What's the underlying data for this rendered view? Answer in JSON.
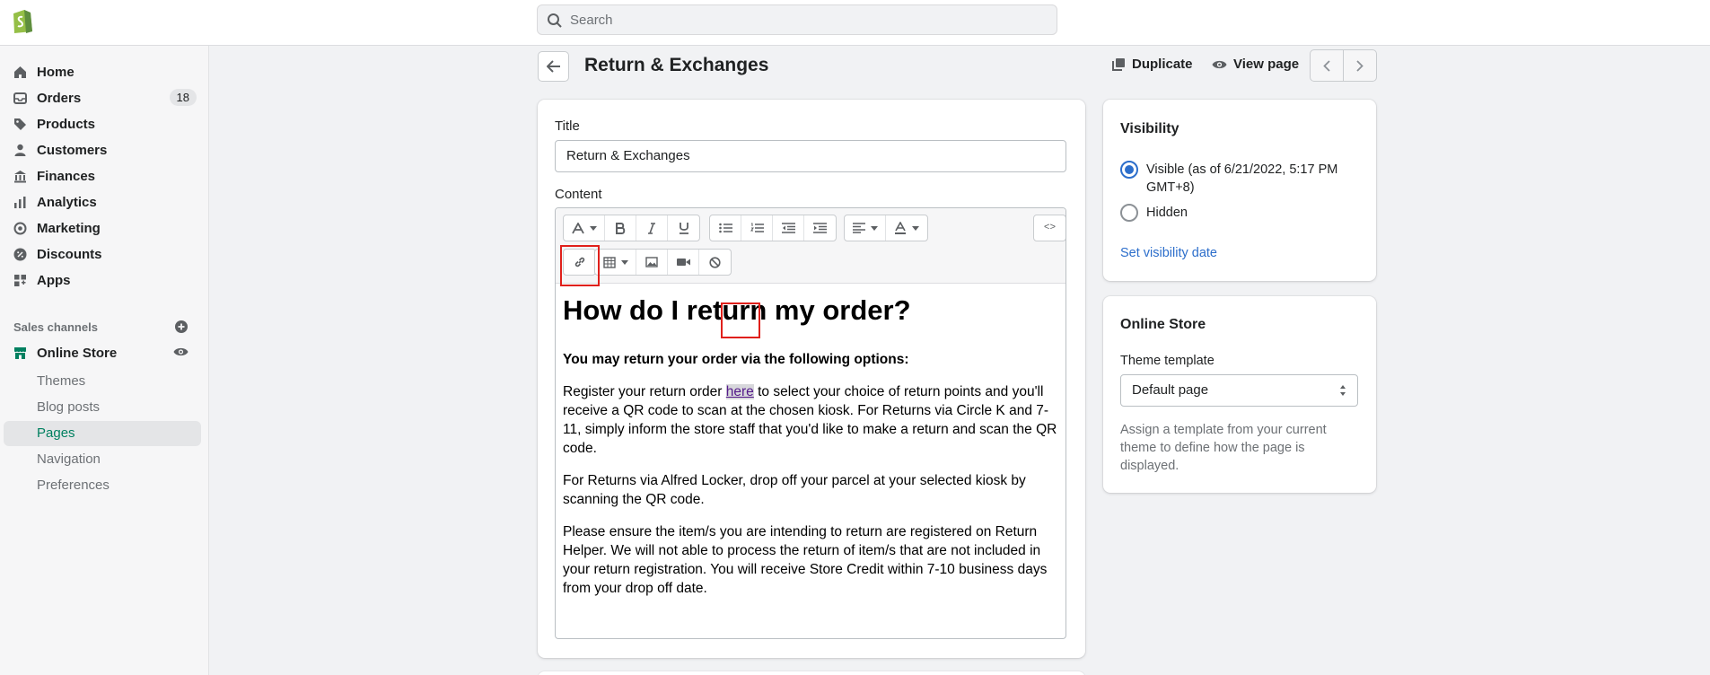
{
  "search": {
    "placeholder": "Search"
  },
  "sidebar": {
    "items": [
      {
        "label": "Home",
        "icon": "home-icon"
      },
      {
        "label": "Orders",
        "icon": "orders-icon",
        "badge": "18"
      },
      {
        "label": "Products",
        "icon": "tag-icon"
      },
      {
        "label": "Customers",
        "icon": "person-icon"
      },
      {
        "label": "Finances",
        "icon": "bank-icon"
      },
      {
        "label": "Analytics",
        "icon": "bar-chart-icon"
      },
      {
        "label": "Marketing",
        "icon": "target-icon"
      },
      {
        "label": "Discounts",
        "icon": "discount-icon"
      },
      {
        "label": "Apps",
        "icon": "apps-grid-icon"
      }
    ],
    "sales_channels_title": "Sales channels",
    "online_store": "Online Store",
    "sub_items": [
      "Themes",
      "Blog posts",
      "Pages",
      "Navigation",
      "Preferences"
    ],
    "active_sub_item": "Pages"
  },
  "header": {
    "title": "Return & Exchanges",
    "duplicate_label": "Duplicate",
    "view_page_label": "View page"
  },
  "form": {
    "title_label": "Title",
    "title_value": "Return & Exchanges",
    "content_label": "Content"
  },
  "toolbar": {
    "source_label": "<>"
  },
  "content": {
    "heading": "How do I return my order?",
    "subheading": "You may return your order via the following options:",
    "p1_before": "Register your return order ",
    "p1_link": "here",
    "p1_after": " to select your choice of return points and you'll receive a QR code to scan at the chosen kiosk. For Returns via Circle K and 7-11, simply inform the store staff that you'd like to make a return and scan the QR code.",
    "p2": "For Returns via Alfred Locker, drop off your parcel at your selected kiosk by scanning the QR code.",
    "p3": "Please ensure the item/s you are intending to return are registered on Return Helper. We will not able to process the return of item/s that are not included in your return registration. You will receive Store Credit within 7-10 business days from your drop off date."
  },
  "visibility": {
    "title": "Visibility",
    "visible_label": "Visible (as of 6/21/2022, 5:17 PM GMT+8)",
    "hidden_label": "Hidden",
    "selected": "Visible",
    "set_date_link": "Set visibility date"
  },
  "online_store": {
    "title": "Online Store",
    "template_label": "Theme template",
    "template_value": "Default page",
    "help_text": "Assign a template from your current theme to define how the page is displayed."
  },
  "colors": {
    "accent": "#2c6ecb",
    "brand_green": "#008060",
    "highlight_red": "#e0201b"
  }
}
